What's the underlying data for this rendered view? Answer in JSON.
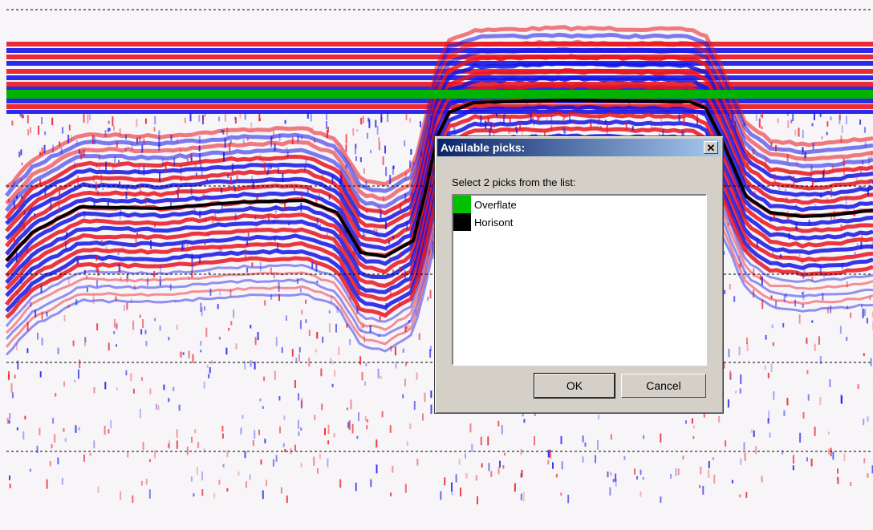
{
  "dialog": {
    "title": "Available picks:",
    "close_glyph": "✕",
    "prompt": "Select 2 picks from the list:",
    "picks": [
      {
        "label": "Overflate",
        "color": "#00c000"
      },
      {
        "label": "Horisont",
        "color": "#000000"
      }
    ],
    "ok_label": "OK",
    "cancel_label": "Cancel"
  },
  "colors": {
    "positive": "#e8141e",
    "negative": "#1414e6",
    "surface_pick": "#00b400",
    "horizon_pick": "#000000",
    "gridline": "#000000"
  }
}
